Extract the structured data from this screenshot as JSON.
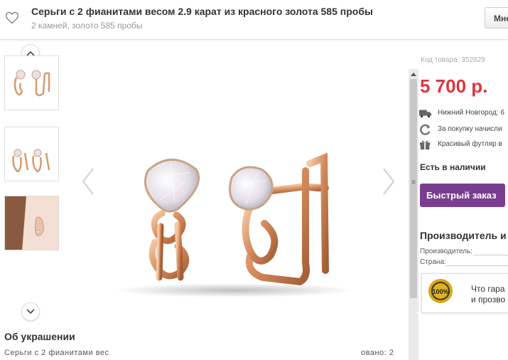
{
  "header": {
    "title": "Серьги с 2 фианитами весом 2.9 карат из красного золота 585 пробы",
    "subtitle": "2 камней, золото 585 пробы",
    "button_label": "Мне"
  },
  "product": {
    "sku": "Код товара: 352829",
    "price": "5 700 р.",
    "delivery": "Нижний Новгород: 6",
    "bonus": "За покупку начисли",
    "packaging": "Красивый футляр в",
    "stock": "Есть в наличии",
    "buy_label": "Быстрый заказ"
  },
  "manufacturer": {
    "title": "Производитель и",
    "producer_label": "Производитель:",
    "country_label": "Страна:"
  },
  "guarantee": {
    "line1": "Что гара",
    "line2": "и прозво",
    "seal_text": "100%"
  },
  "about": {
    "title": "Об украшении",
    "text_left": "Серьги с 2 фианитами вес",
    "text_right": "овано: 2"
  },
  "icons": {
    "favorite": "heart-icon",
    "up": "chevron-up-icon",
    "down": "chevron-down-icon",
    "prev": "chevron-left-icon",
    "next": "chevron-right-icon",
    "truck": "truck-icon",
    "refresh": "refresh-icon",
    "gift": "gift-icon"
  },
  "colors": {
    "price": "#e0353e",
    "buy_button": "#7a3e90",
    "gold": "#d89a6e"
  }
}
